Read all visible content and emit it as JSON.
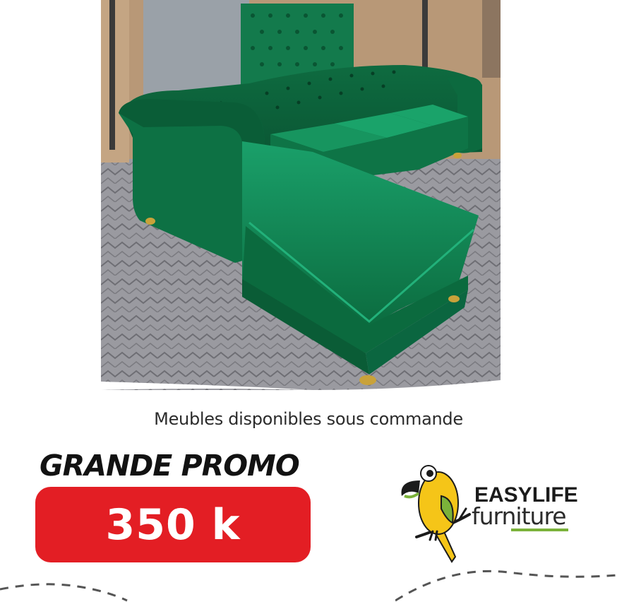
{
  "tagline": "Meubles disponibles sous commande",
  "promo": {
    "title": "GRANDE PROMO",
    "price": "350 k"
  },
  "brand": {
    "name": "EASYLIFE",
    "subtitle": "furniture",
    "logo_icon": "parrot-icon"
  },
  "colors": {
    "promo_red": "#e31e24",
    "sofa_green": "#0f7a4a",
    "brand_green": "#7bb23a",
    "parrot_yellow": "#f5c518"
  }
}
